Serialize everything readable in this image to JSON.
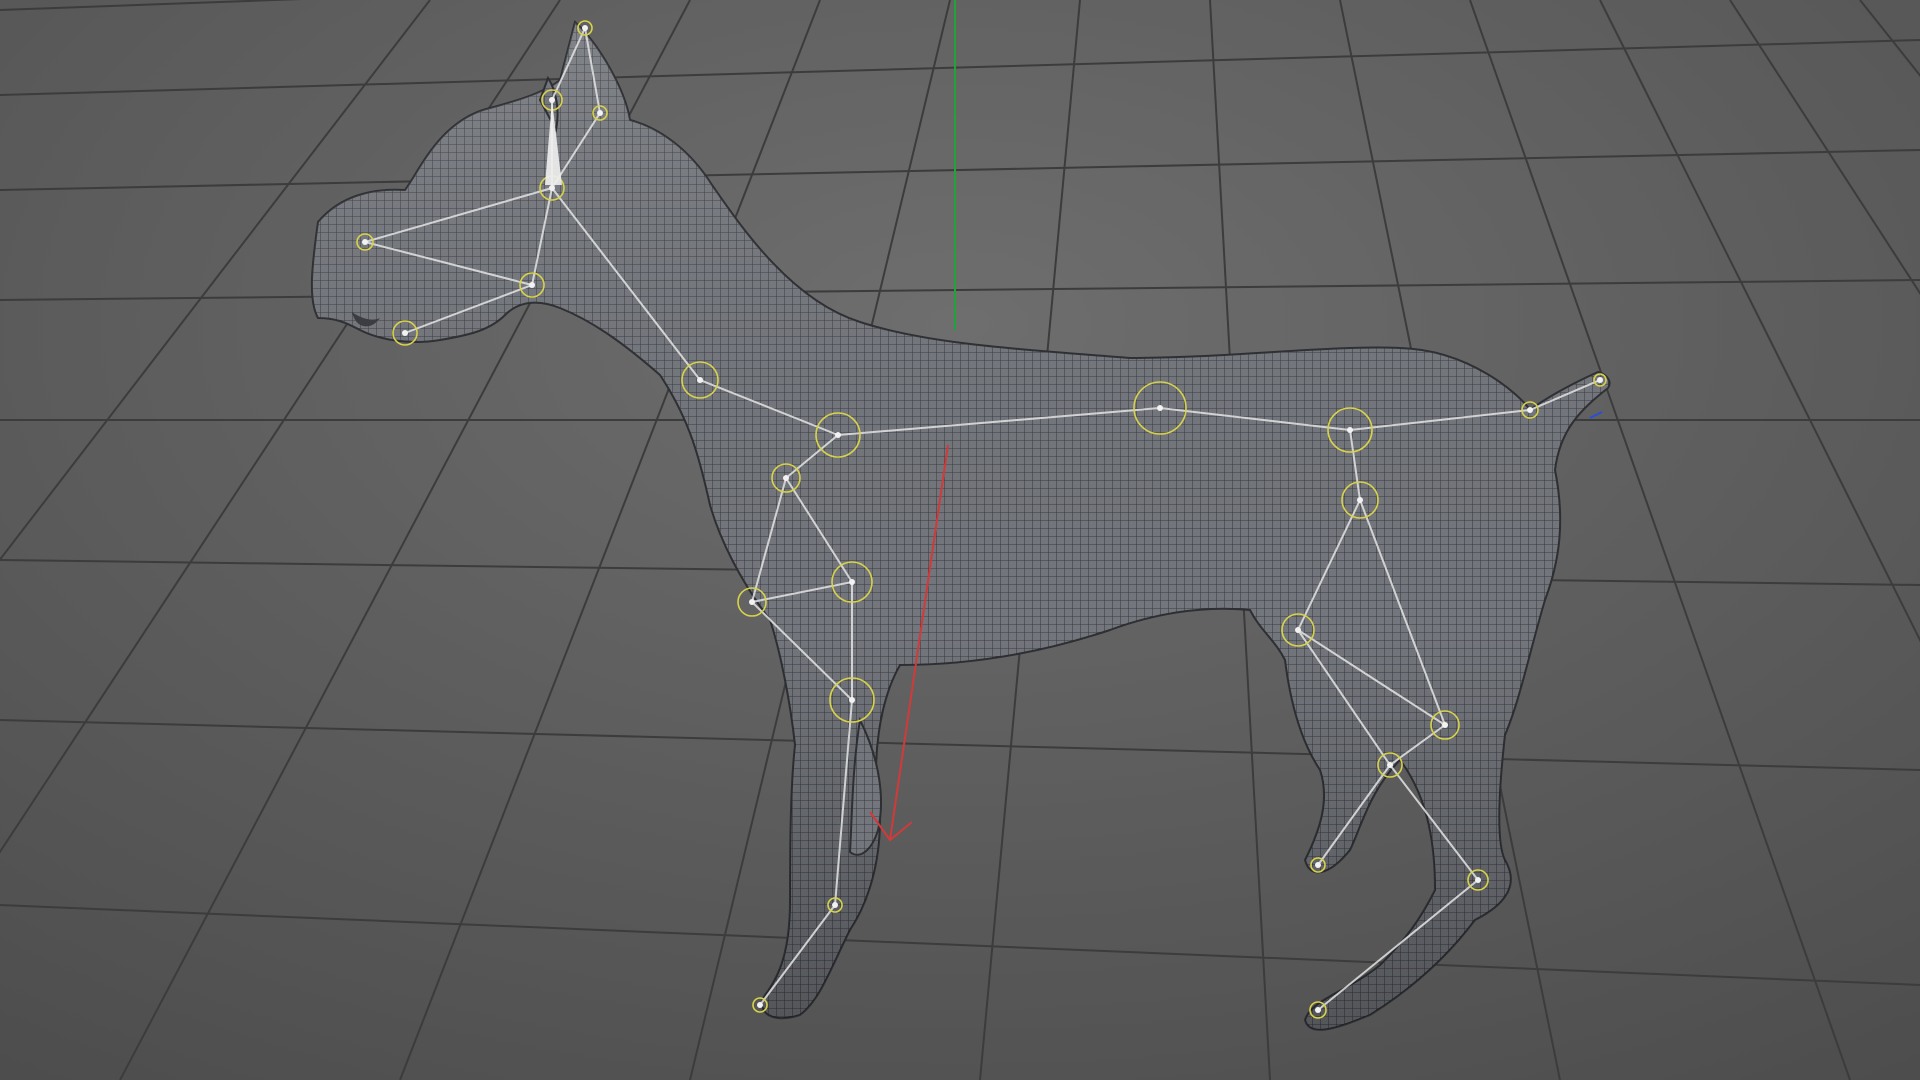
{
  "viewport": {
    "background": "#5f5f5f",
    "grid_color": "#3f3f3f",
    "grid_visible": true,
    "axis_y_color": "#1fa33a",
    "axis_x_color": "#d23a3a",
    "axis_z_color": "#2a4fd6"
  },
  "model": {
    "mesh_color": "#70737a",
    "wire_color": "#3a3c42",
    "bone_color": "#e4e4e4",
    "joint_color": "#d8d24a"
  }
}
